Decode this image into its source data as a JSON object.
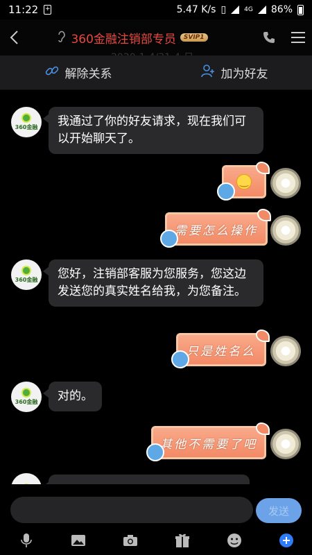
{
  "status": {
    "time": "11:22",
    "speed": "5.47 K/s",
    "battery": "86%",
    "sim": "+",
    "network": "4G"
  },
  "header": {
    "title": "360金融注销部专员",
    "badge": "SVIP1",
    "ghost_date": "2020-1-4/31-4-日"
  },
  "actions": {
    "unfriend": "解除关系",
    "add_friend": "加为好友"
  },
  "messages": {
    "m1": "我通过了你的好友请求，现在我们可以开始聊天了。",
    "m2": "您好，注销部客服为您服务，您这边发送您的真实姓名给我，为您备注。",
    "m3": "对的。",
    "s2": "需要怎么操作",
    "s3": "只是姓名么",
    "s4": "其他不需要了吧"
  },
  "avatar_label": "360金融",
  "input": {
    "placeholder": "",
    "send": "发送"
  },
  "colors": {
    "title": "#e8483f",
    "send": "#6ca3e8",
    "accent": "#2f7cf6"
  },
  "icons": [
    "back-arrow-icon",
    "ear-icon",
    "phone-icon",
    "menu-icon",
    "unlink-icon",
    "add-friend-icon",
    "mic-icon",
    "image-icon",
    "camera-icon",
    "gift-icon",
    "emoji-icon",
    "plus-icon"
  ]
}
